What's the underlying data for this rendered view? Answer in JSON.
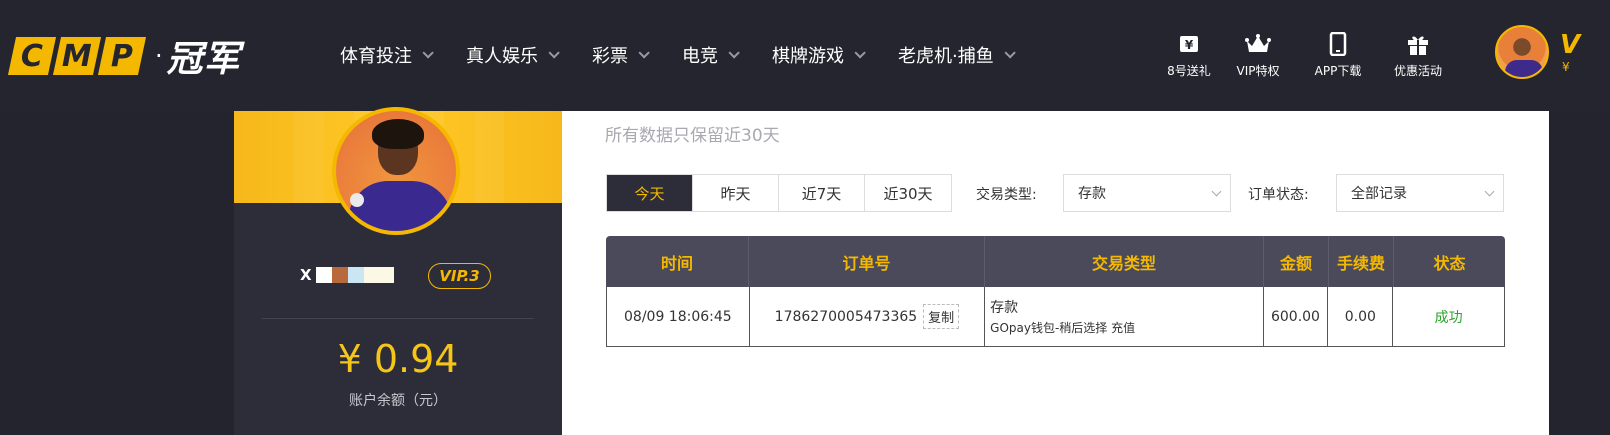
{
  "header": {
    "logo_text": "CMP",
    "logo_cn": "冠军",
    "nav": [
      {
        "label": "体育投注"
      },
      {
        "label": "真人娱乐"
      },
      {
        "label": "彩票"
      },
      {
        "label": "电竞"
      },
      {
        "label": "棋牌游戏"
      },
      {
        "label": "老虎机·捕鱼"
      }
    ],
    "tools": [
      {
        "label": "8号送礼",
        "icon": "ticket-icon"
      },
      {
        "label": "VIP特权",
        "icon": "crown-icon"
      },
      {
        "label": "APP下载",
        "icon": "phone-icon"
      },
      {
        "label": "优惠活动",
        "icon": "gift-icon"
      }
    ],
    "vip_fragment": "V",
    "vip_fragment2": "¥"
  },
  "profile": {
    "username": "X",
    "vip_level": "VIP.3",
    "balance": "¥ 0.94",
    "balance_label": "账户余额（元）"
  },
  "main": {
    "note": "所有数据只保留近30天",
    "date_tabs": [
      {
        "label": "今天",
        "active": true
      },
      {
        "label": "昨天",
        "active": false
      },
      {
        "label": "近7天",
        "active": false
      },
      {
        "label": "近30天",
        "active": false
      }
    ],
    "type_filter_label": "交易类型:",
    "type_filter_value": "存款",
    "status_filter_label": "订单状态:",
    "status_filter_value": "全部记录"
  },
  "table": {
    "headers": [
      "时间",
      "订单号",
      "交易类型",
      "金额",
      "手续费",
      "状态"
    ],
    "rows": [
      {
        "time": "08/09 18:06:45",
        "order_no": "1786270005473365",
        "copy_label": "复制",
        "type_main": "存款",
        "type_sub": "GOpay钱包-稍后选择 充值",
        "amount": "600.00",
        "fee": "0.00",
        "status": "成功"
      }
    ]
  },
  "colors": {
    "accent": "#f5b800",
    "dark": "#25252f",
    "success": "#2aa52a"
  }
}
